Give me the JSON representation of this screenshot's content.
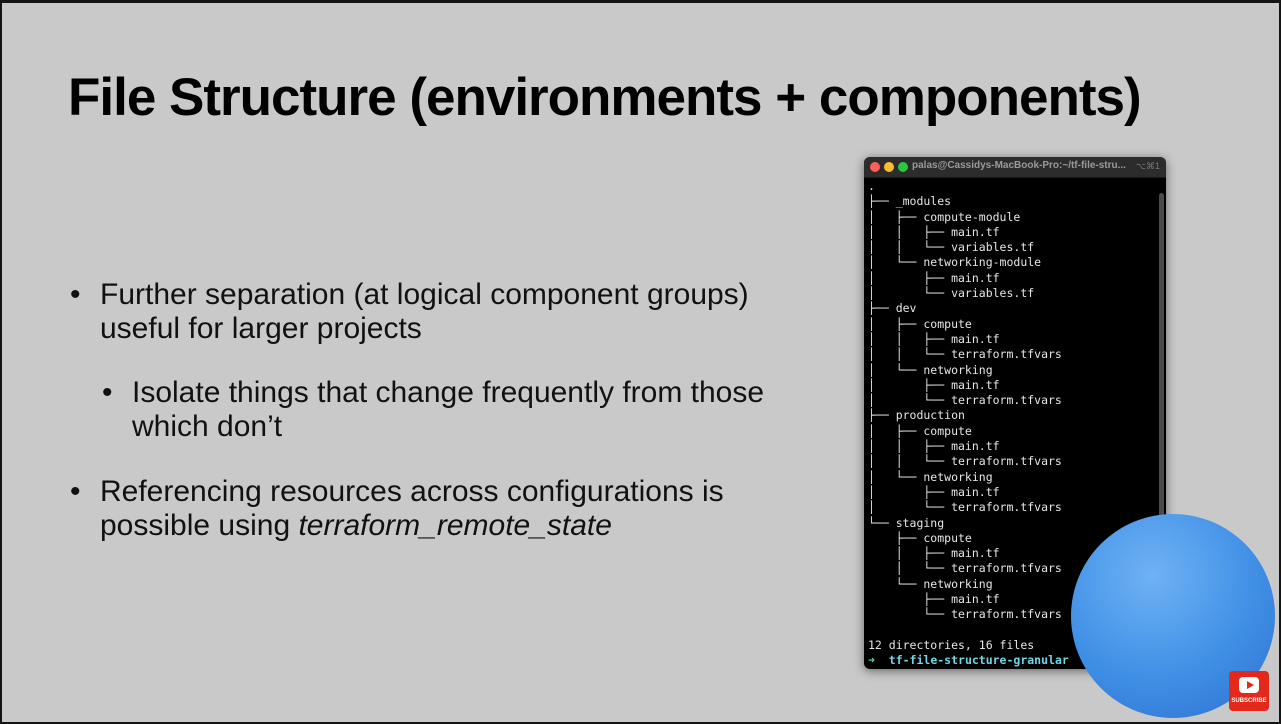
{
  "slide": {
    "title": "File Structure (environments + components)",
    "bullets": [
      {
        "text": "Further separation (at logical component groups) useful for larger projects"
      },
      {
        "text": "Isolate things that change frequently from those which don’t"
      },
      {
        "text_prefix": "Referencing resources across configurations is possible using ",
        "text_italic": "terraform_remote_state"
      }
    ],
    "bullet_glyph": "•"
  },
  "terminal": {
    "title": "palas@Cassidys-MacBook-Pro:~/tf-file-stru...",
    "shortcut": "⌥⌘1",
    "lines": [
      ".",
      "├── _modules",
      "│   ├── compute-module",
      "│   │   ├── main.tf",
      "│   │   └── variables.tf",
      "│   └── networking-module",
      "│       ├── main.tf",
      "│       └── variables.tf",
      "├── dev",
      "│   ├── compute",
      "│   │   ├── main.tf",
      "│   │   └── terraform.tfvars",
      "│   └── networking",
      "│       ├── main.tf",
      "│       └── terraform.tfvars",
      "├── production",
      "│   ├── compute",
      "│   │   ├── main.tf",
      "│   │   └── terraform.tfvars",
      "│   └── networking",
      "│       ├── main.tf",
      "│       └── terraform.tfvars",
      "└── staging",
      "    ├── compute",
      "    │   ├── main.tf",
      "    │   └── terraform.tfvars",
      "    └── networking",
      "        ├── main.tf",
      "        └── terraform.tfvars",
      "",
      "12 directories, 16 files"
    ],
    "prompt_arrow": "➜",
    "prompt_dir": "tf-file-structure-granular"
  },
  "overlay": {
    "subscribe_label": "SUBSCRIBE"
  },
  "colors": {
    "slide_bg": "#c9c9c9",
    "terminal_bg": "#000000",
    "subscribe_red": "#e4281b"
  }
}
